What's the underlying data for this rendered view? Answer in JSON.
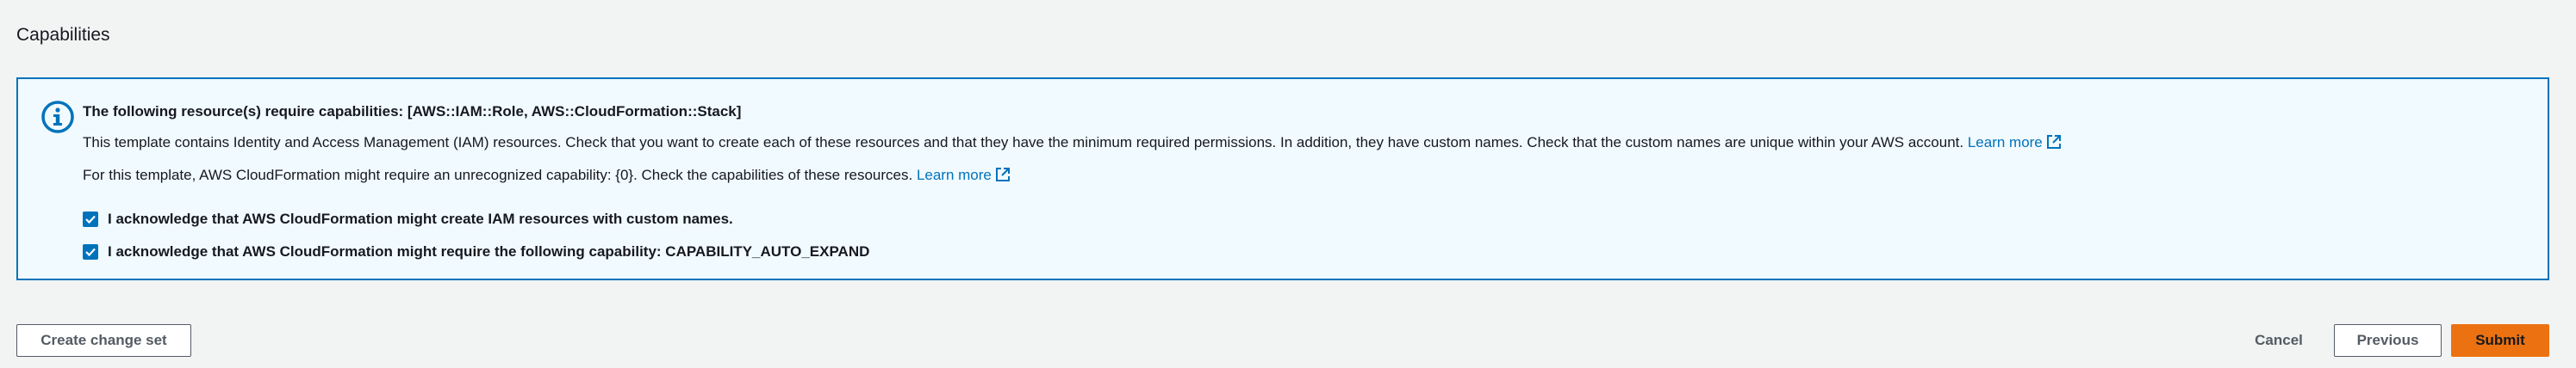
{
  "section": {
    "title": "Capabilities"
  },
  "alert": {
    "icon": "info-icon",
    "heading": "The following resource(s) require capabilities: [AWS::IAM::Role, AWS::CloudFormation::Stack]",
    "text1": "This template contains Identity and Access Management (IAM) resources. Check that you want to create each of these resources and that they have the minimum required permissions. In addition, they have custom names. Check that the custom names are unique within your AWS account.",
    "text1_link": "Learn more",
    "text2": "For this template, AWS CloudFormation might require an unrecognized capability: {0}. Check the capabilities of these resources.",
    "text2_link": "Learn more",
    "acknowledgements": [
      {
        "label": "I acknowledge that AWS CloudFormation might create IAM resources with custom names.",
        "checked": true
      },
      {
        "label": "I acknowledge that AWS CloudFormation might require the following capability: CAPABILITY_AUTO_EXPAND",
        "checked": true
      }
    ]
  },
  "footer": {
    "create_change_set_label": "Create change set",
    "cancel_label": "Cancel",
    "previous_label": "Previous",
    "submit_label": "Submit"
  },
  "colors": {
    "background": "#f2f3f3",
    "alert_border": "#0073bb",
    "alert_background": "#f1faff",
    "link": "#0073bb",
    "primary_button": "#ec7211"
  }
}
